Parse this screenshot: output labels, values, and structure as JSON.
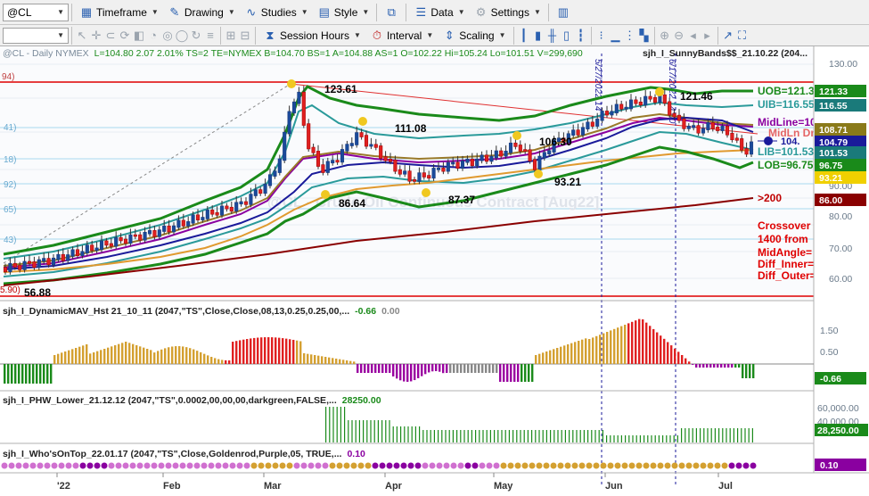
{
  "toolbar": {
    "symbol": "@CL",
    "timeframe": "Timeframe",
    "drawing": "Drawing",
    "studies": "Studies",
    "style": "Style",
    "data": "Data",
    "settings": "Settings",
    "session_hours": "Session Hours",
    "interval": "Interval",
    "scaling": "Scaling"
  },
  "header": {
    "symbol_info": "@CL - Daily  NYMEX",
    "quote": "L=104.80  2.07  2.01%  TS=2  TE=NYMEX  B=104.70  BS=1  A=104.88  AS=1  O=102.22  Hi=105.24  Lo=101.51  V=299,690",
    "study": "sjh_I_SunnyBands$$_21.10.22 (204...",
    "watermark": "@CL - Crude Oil Continuous Contract [Aug22]",
    "vline1": "5/27/2022 14",
    "vline2": "6/17/2022 14:00"
  },
  "left_edge_labels": [
    "94)",
    "41)",
    "18)",
    "92)",
    "65)",
    "43)",
    "5.90)"
  ],
  "price_labels": {
    "high": "123.61",
    "june_high": "121.46",
    "mar_low": "86.64",
    "apr_low": "87.37",
    "apr_high": "111.08",
    "may_mid": "106.30",
    "may_low": "93.21",
    "start_low": "56.88",
    "right_price": "104."
  },
  "band_labels": {
    "uob": "UOB=121.3",
    "uib": "UIB=116.55",
    "midline": "MidLine=10",
    "midline2": "MidLn Dn",
    "lib": "LIB=101.53",
    "lob": "LOB=96.75",
    "ma200": ">200"
  },
  "crossover_text": [
    "Crossover",
    "1400 from",
    "MidAngle=",
    "Diff_Inner=",
    "Diff_Outer="
  ],
  "price_axis": {
    "ticks": [
      "130.00",
      "90.00",
      "80.00",
      "70.00",
      "60.00"
    ],
    "badges": [
      {
        "text": "121.33",
        "bg": "#1a8a1a",
        "fg": "#ffffff"
      },
      {
        "text": "116.55",
        "bg": "#1a7a7a",
        "fg": "#ffffff"
      },
      {
        "text": "108.71",
        "bg": "#8a7a1a",
        "fg": "#ffffff"
      },
      {
        "text": "104.79",
        "bg": "#1a1a9a",
        "fg": "#ffffff"
      },
      {
        "text": "101.53",
        "bg": "#1a7a7a",
        "fg": "#ffffff"
      },
      {
        "text": "96.75",
        "bg": "#1a8a1a",
        "fg": "#ffffff"
      },
      {
        "text": "93.21",
        "bg": "#f0d000",
        "fg": "#ffffff"
      },
      {
        "text": "86.00",
        "bg": "#8a0000",
        "fg": "#ffffff"
      }
    ]
  },
  "panes": {
    "mav": {
      "label": "sjh_I_DynamicMAV_Hst 21_10_11 (2047,\"TS\",Close,Close,08,13,0.25,0.25,00,...",
      "v1": "-0.66",
      "v2": "0.00",
      "ticks": [
        "1.50",
        "0.50"
      ],
      "badge": "-0.66"
    },
    "phw": {
      "label": "sjh_I_PHW_Lower_21.12.12 (2047,\"TS\",0.0002,00,00,00,darkgreen,FALSE,...",
      "v1": "28250.00",
      "ticks": [
        "60,000.00",
        "40,000.00"
      ],
      "badge": "28,250.00"
    },
    "who": {
      "label": "sjh_I_Who'sOnTop_22.01.17 (2047,\"TS\",Close,Goldenrod,Purple,05, TRUE,...",
      "v1": "0.10",
      "badge": "0.10"
    }
  },
  "time_axis": [
    "'22",
    "Feb",
    "Mar",
    "Apr",
    "May",
    "Jun",
    "Jul"
  ],
  "colors": {
    "red": "#e00000",
    "green": "#1a8a1a",
    "purple": "#8a00a0",
    "navy": "#1a1a9a",
    "gold": "#d4a030",
    "teal": "#2a9a9a"
  }
}
